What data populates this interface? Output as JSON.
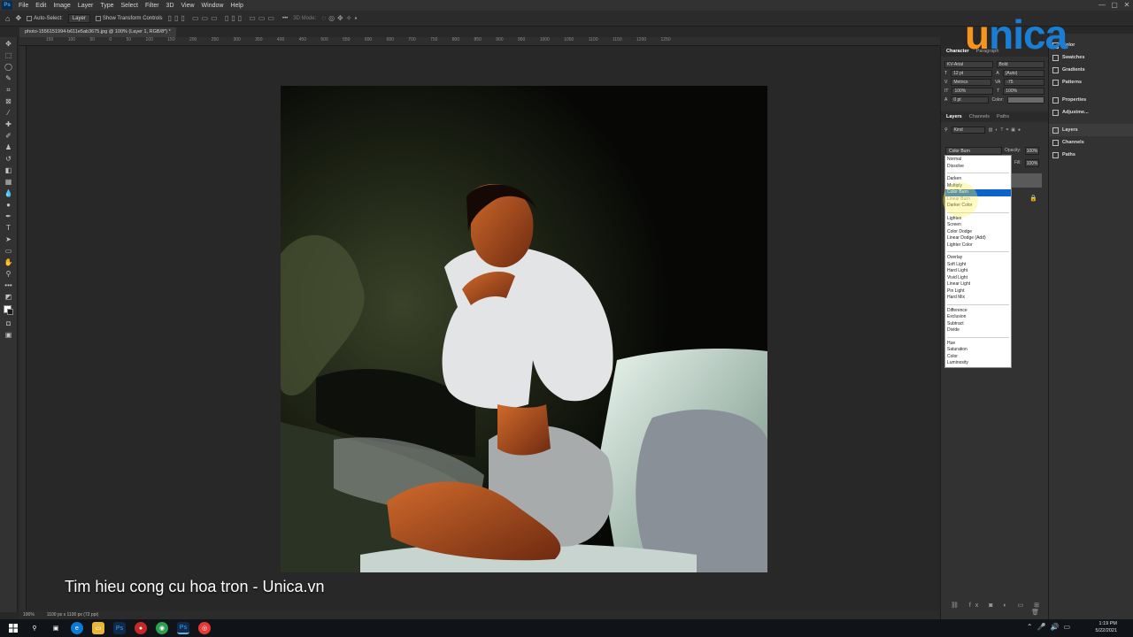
{
  "app": {
    "menu": [
      "File",
      "Edit",
      "Image",
      "Layer",
      "Type",
      "Select",
      "Filter",
      "3D",
      "View",
      "Window",
      "Help"
    ],
    "window_controls": [
      "—",
      "▢",
      "✕"
    ]
  },
  "options_bar": {
    "auto_select_label": "Auto-Select:",
    "auto_select_target": "Layer",
    "transform_label": "Show Transform Controls",
    "mode_label": "3D Mode:"
  },
  "document": {
    "tab_title": "photo-1556151994-b611e5ab3675.jpg @ 100% (Layer 1, RGB/8*) *",
    "ruler_ticks": "150  100  50  0  50  100  150  200  250  300  350  400  450  500  550  600  650  700  750  800  850  900  950  1000  1050  1100  1150  1200  1250"
  },
  "status": {
    "zoom": "100%",
    "size": "1100 px x 1100 px (72 ppi)"
  },
  "caption": "Tim hieu cong cu hoa tron - Unica.vn",
  "watermark": {
    "first": "u",
    "rest": "nica"
  },
  "character_panel": {
    "tabs": [
      "Character",
      "Paragraph"
    ],
    "font_family": "KV-Arial",
    "font_style": "Bold",
    "size": "12 pt",
    "leading": "(Auto)",
    "kerning": "Metrics",
    "tracking": "-75",
    "vscale": "100%",
    "hscale": "100%",
    "baseline": "0 pt",
    "color_label": "Color:"
  },
  "layers_panel": {
    "tabs": [
      "Layers",
      "Channels",
      "Paths"
    ],
    "filter_kind": "Kind",
    "blend_mode": "Color Burn",
    "opacity_label": "Opacity:",
    "opacity": "100%",
    "fill_label": "Fill:",
    "fill": "100%"
  },
  "blend_dropdown": {
    "group1": [
      "Normal",
      "Dissolve"
    ],
    "group2": [
      "Darken",
      "Multiply",
      "Color Burn",
      "Linear Burn",
      "Darker Color"
    ],
    "group3": [
      "Lighten",
      "Screen",
      "Color Dodge",
      "Linear Dodge (Add)",
      "Lighter Color"
    ],
    "group4": [
      "Overlay",
      "Soft Light",
      "Hard Light",
      "Vivid Light",
      "Linear Light",
      "Pin Light",
      "Hard Mix"
    ],
    "group5": [
      "Difference",
      "Exclusion",
      "Subtract",
      "Divide"
    ],
    "group6": [
      "Hue",
      "Saturation",
      "Color",
      "Luminosity"
    ],
    "selected": "Color Burn"
  },
  "right_panels": {
    "items": [
      "Color",
      "Swatches",
      "Gradients",
      "Patterns",
      "Properties",
      "Adjustme...",
      "Layers",
      "Channels",
      "Paths"
    ]
  },
  "taskbar": {
    "time": "1:19 PM",
    "date": "5/22/2021"
  }
}
